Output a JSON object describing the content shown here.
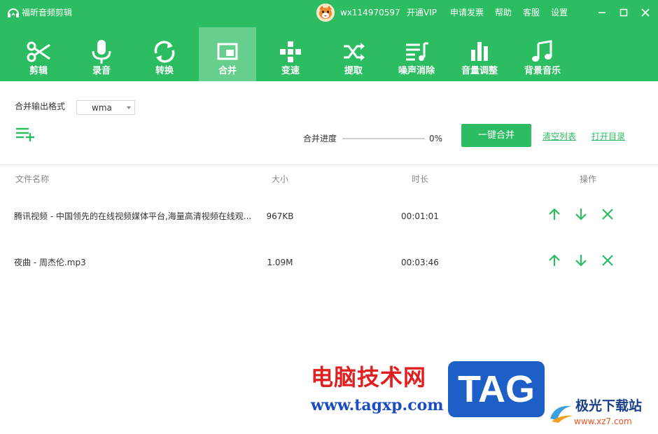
{
  "app": {
    "title": "福昕音频剪辑",
    "username": "wx114970597",
    "top_links": [
      "开通VIP",
      "申请发票",
      "帮助",
      "客服",
      "设置"
    ],
    "accent_color": "#2cbd62"
  },
  "tabs": [
    {
      "label": "剪辑",
      "icon": "scissors-icon"
    },
    {
      "label": "录音",
      "icon": "microphone-icon"
    },
    {
      "label": "转换",
      "icon": "convert-icon"
    },
    {
      "label": "合并",
      "icon": "merge-icon",
      "active": true
    },
    {
      "label": "变速",
      "icon": "speed-icon"
    },
    {
      "label": "提取",
      "icon": "extract-icon"
    },
    {
      "label": "噪声消除",
      "icon": "denoise-icon"
    },
    {
      "label": "音量调整",
      "icon": "volume-bars-icon"
    },
    {
      "label": "背景音乐",
      "icon": "music-note-icon"
    }
  ],
  "toolbar": {
    "format_label": "合并输出格式",
    "format_value": "wma",
    "progress_label": "合并进度",
    "progress_percent": 0,
    "progress_text": "0%",
    "merge_button": "一键合并",
    "clear_list": "清空列表",
    "open_folder": "打开目录"
  },
  "table": {
    "columns": [
      "文件名称",
      "大小",
      "时长",
      "操作"
    ],
    "rows": [
      {
        "name": "腾讯视频 - 中国领先的在线视频媒体平台,海量高清视频在线观...",
        "size": "967KB",
        "duration": "00:01:01"
      },
      {
        "name": "夜曲 - 周杰伦.mp3",
        "size": "1.09M",
        "duration": "00:03:46"
      }
    ]
  },
  "watermark": {
    "cn": "电脑技术网",
    "url": "www.tagxp.com",
    "tag": "TAG",
    "site_cn": "极光下载站",
    "site_url": "www.xz7.com"
  }
}
